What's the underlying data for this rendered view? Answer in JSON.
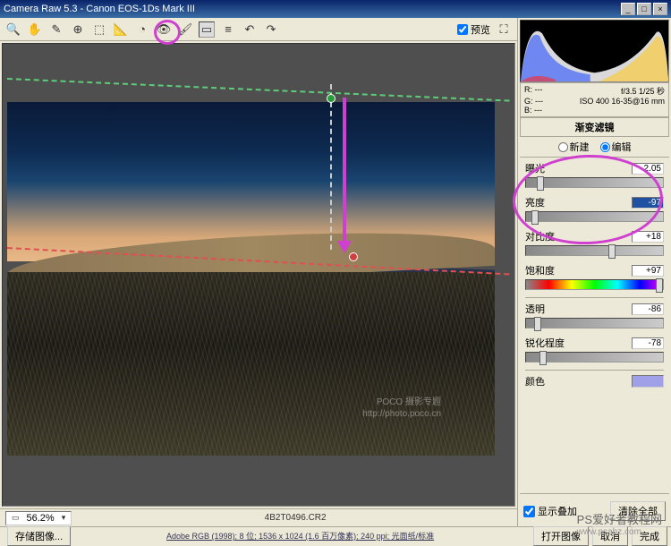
{
  "title": "Camera Raw 5.3 - Canon EOS-1Ds Mark III",
  "toolbar": {
    "preview_label": "预览"
  },
  "preview": {
    "filename": "4B2T0496.CR2",
    "zoom": "56.2%",
    "watermark_main": "POCO 摄影专题",
    "watermark_url": "http://photo.poco.cn"
  },
  "info": {
    "r_label": "R:",
    "r_val": "---",
    "g_label": "G:",
    "g_val": "---",
    "b_label": "B:",
    "b_val": "---",
    "aperture": "f/3.5  1/25 秒",
    "iso": "ISO 400  16-35@16 mm"
  },
  "panel": {
    "title": "渐变滤镜",
    "mode_new": "新建",
    "mode_edit": "编辑"
  },
  "sliders": {
    "exposure": {
      "label": "曝光",
      "value": "-2.05",
      "pos": 8
    },
    "brightness": {
      "label": "亮度",
      "value": "-97",
      "pos": 4
    },
    "contrast": {
      "label": "对比度",
      "value": "+18",
      "pos": 60
    },
    "saturation": {
      "label": "饱和度",
      "value": "+97",
      "pos": 95
    },
    "clarity": {
      "label": "透明",
      "value": "-86",
      "pos": 6
    },
    "sharpness": {
      "label": "锐化程度",
      "value": "-78",
      "pos": 10
    },
    "color": {
      "label": "颜色",
      "swatch": "#9fa0e8"
    }
  },
  "bottom": {
    "overlay_label": "显示叠加",
    "clear_btn": "清除全部"
  },
  "footer": {
    "save_btn": "存储图像...",
    "info": "Adobe RGB (1998); 8 位; 1536 x 1024 (1.6 百万像素); 240 ppi; 光面纸/标准",
    "open_btn": "打开图像",
    "cancel_btn": "取消",
    "done_btn": "完成"
  },
  "ext_wm": {
    "text": "PS爱好者教程网",
    "url": "www.psahz.com"
  }
}
